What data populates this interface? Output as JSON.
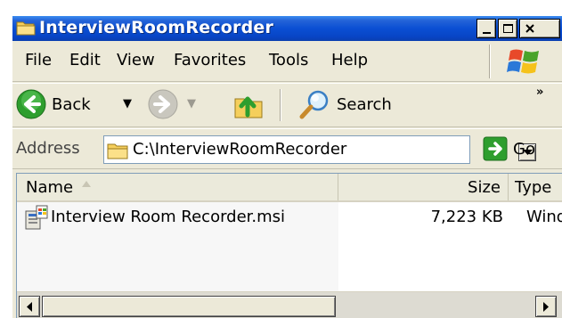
{
  "window": {
    "title": "InterviewRoomRecorder"
  },
  "menu": {
    "file": "File",
    "edit": "Edit",
    "view": "View",
    "favorites": "Favorites",
    "tools": "Tools",
    "help": "Help"
  },
  "toolbar": {
    "back_label": "Back",
    "search_label": "Search",
    "chevron": "»"
  },
  "address": {
    "label": "Address",
    "value": "C:\\InterviewRoomRecorder",
    "go_label": "Go"
  },
  "list": {
    "columns": {
      "name": "Name",
      "size": "Size",
      "type": "Type"
    },
    "rows": [
      {
        "name": "Interview Room Recorder.msi",
        "size": "7,223 KB",
        "type": "Windows Installer Package"
      }
    ]
  },
  "icons": {
    "title": "folder-icon",
    "back": "back-arrow-icon",
    "forward": "forward-arrow-icon",
    "up": "up-folder-icon",
    "search": "search-magnifier-icon",
    "address": "folder-icon",
    "go": "go-arrow-icon",
    "file": "msi-installer-icon"
  },
  "colors": {
    "titlebar": "#0a4fd3",
    "chrome": "#ece9d8",
    "back_green": "#2e9e2e",
    "selection_column": "#f7f7f7"
  }
}
